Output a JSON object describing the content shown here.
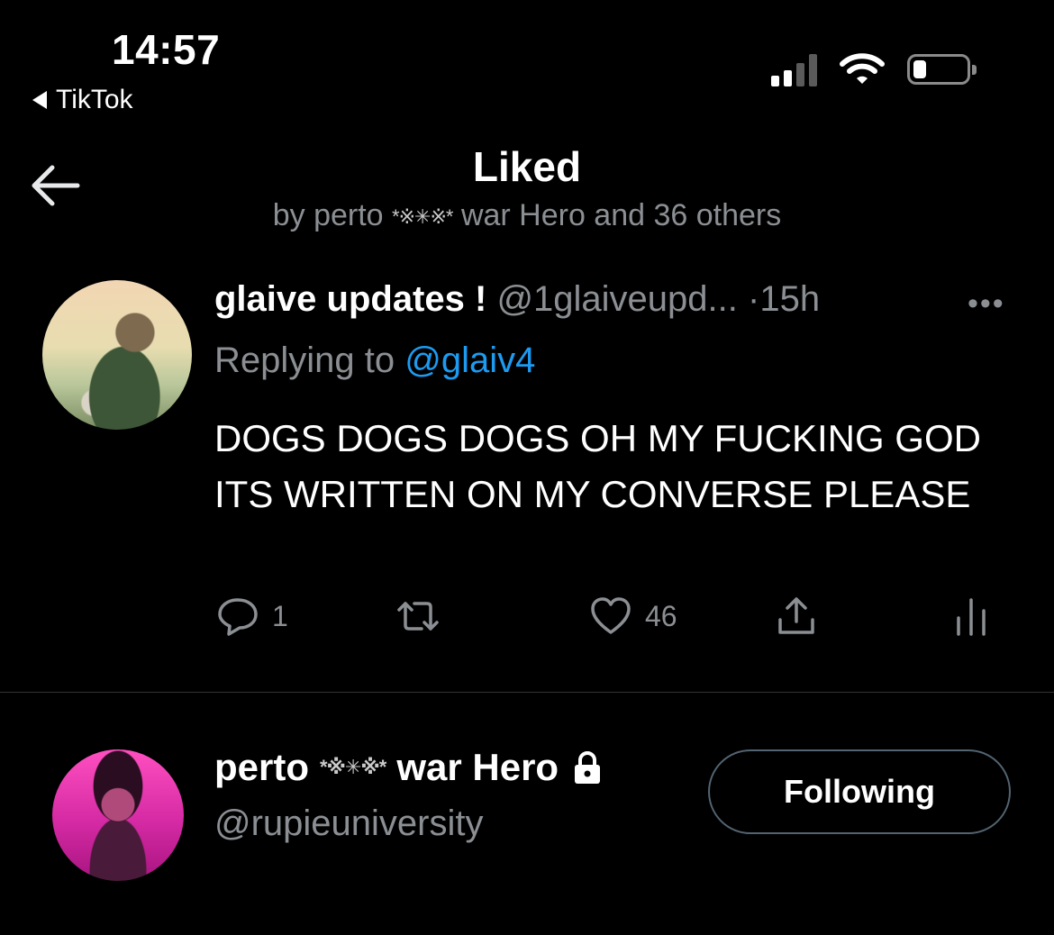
{
  "status_bar": {
    "time": "14:57",
    "back_app": "TikTok"
  },
  "header": {
    "title": "Liked",
    "subtitle_prefix": "by perto",
    "subtitle_glyph": "*※✳※*",
    "subtitle_suffix": "war Hero and 36 others"
  },
  "tweet": {
    "name": "glaive updates !",
    "handle": "@1glaiveupd...",
    "dot": "·",
    "time": "15h",
    "more": "•••",
    "replying_prefix": "Replying to",
    "replying_to": "@glaiv4",
    "text": "DOGS DOGS DOGS OH MY FUCKING GOD ITS WRITTEN ON MY CONVERSE PLEASE",
    "reply_count": "1",
    "retweet_count": "",
    "like_count": "46"
  },
  "user": {
    "name_first": "perto",
    "name_glyph": "*※✳※*",
    "name_last": "war Hero",
    "handle": "@rupieuniversity",
    "follow_label": "Following"
  },
  "colors": {
    "background": "#000000",
    "link": "#1d9bf0",
    "muted": "#8b8f93",
    "divider": "#2f3336"
  }
}
